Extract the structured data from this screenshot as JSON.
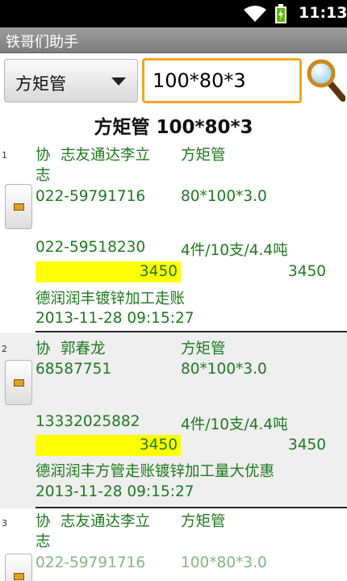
{
  "status_bar": {
    "time": "11:13"
  },
  "app": {
    "title": "铁哥们助手"
  },
  "search": {
    "category": "方矩管",
    "query": "100*80*3"
  },
  "result_heading": "方矩管 100*80*3",
  "records": [
    {
      "index": "1",
      "prefix": "协",
      "company_line1": "志友通达李立",
      "company_line2": "志",
      "product": "方矩管",
      "phone1": "022-59791716",
      "spec": "80*100*3.0",
      "phone2": "022-59518230",
      "quantity": "4件/10支/4.4吨",
      "price": "3450",
      "price_right": "3450",
      "remark": "德润润丰镀锌加工走账",
      "datetime": "2013-11-28  09:15:27"
    },
    {
      "index": "2",
      "prefix": "协",
      "company_line1": "郭春龙",
      "product": "方矩管",
      "phone1": "68587751",
      "spec": "80*100*3.0",
      "phone2": "13332025882",
      "quantity": "4件/10支/4.4吨",
      "price": "3450",
      "price_right": "3450",
      "remark": "德润润丰方管走账镀锌加工量大优惠",
      "datetime": "2013-11-28  09:15:27"
    },
    {
      "index": "3",
      "prefix": "协",
      "company_line1": "志友通达李立",
      "company_line2": "志",
      "product": "方矩管",
      "phone1": "022-59791716",
      "spec": "100*80*3.0"
    }
  ]
}
